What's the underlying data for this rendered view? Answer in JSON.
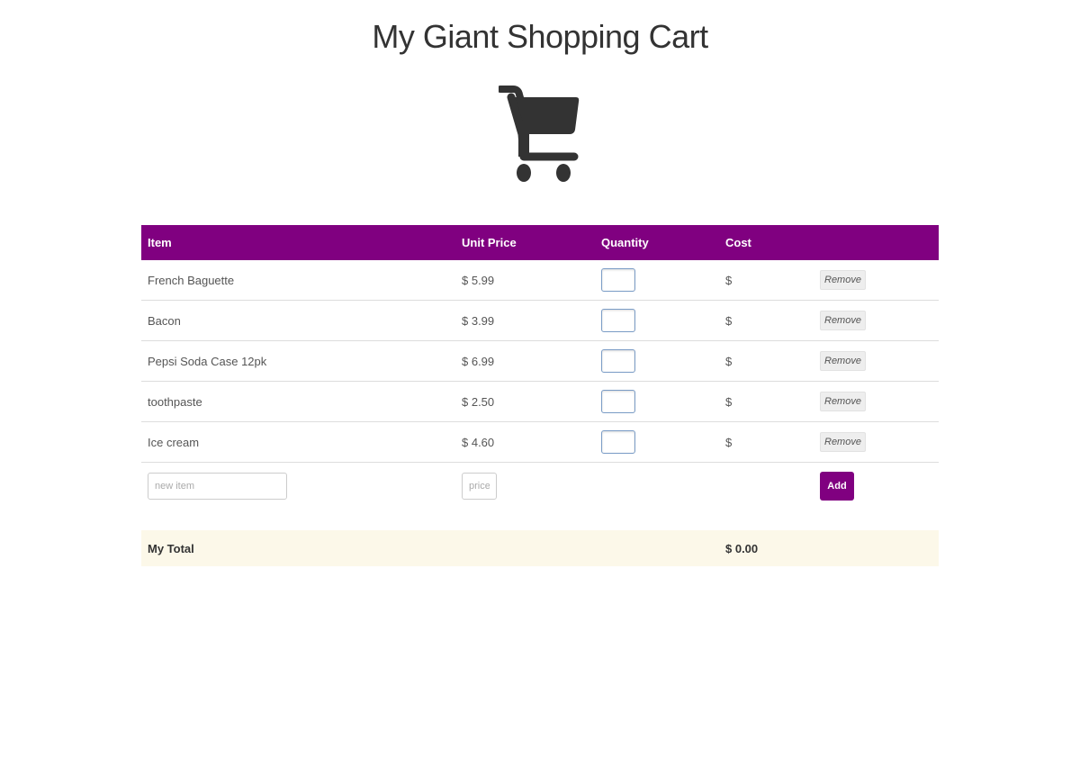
{
  "header": {
    "title": "My Giant Shopping Cart"
  },
  "icon": {
    "cart": "shopping-cart-icon"
  },
  "colors": {
    "accent": "#800080",
    "total_row_bg": "#fcf8e9",
    "text": "#333333"
  },
  "table": {
    "columns": [
      "Item",
      "Unit Price",
      "Quantity",
      "Cost",
      ""
    ],
    "rows": [
      {
        "item": "French Baguette",
        "unit_price": "$ 5.99",
        "quantity": "",
        "cost": "$",
        "remove_label": "Remove"
      },
      {
        "item": "Bacon",
        "unit_price": "$ 3.99",
        "quantity": "",
        "cost": "$",
        "remove_label": "Remove"
      },
      {
        "item": "Pepsi Soda Case 12pk",
        "unit_price": "$ 6.99",
        "quantity": "",
        "cost": "$",
        "remove_label": "Remove"
      },
      {
        "item": "toothpaste",
        "unit_price": "$ 2.50",
        "quantity": "",
        "cost": "$",
        "remove_label": "Remove"
      },
      {
        "item": "Ice cream",
        "unit_price": "$ 4.60",
        "quantity": "",
        "cost": "$",
        "remove_label": "Remove"
      }
    ],
    "add_row": {
      "new_item_placeholder": "new item",
      "price_placeholder": "price",
      "add_label": "Add"
    },
    "total": {
      "label": "My Total",
      "value": "$ 0.00"
    }
  }
}
